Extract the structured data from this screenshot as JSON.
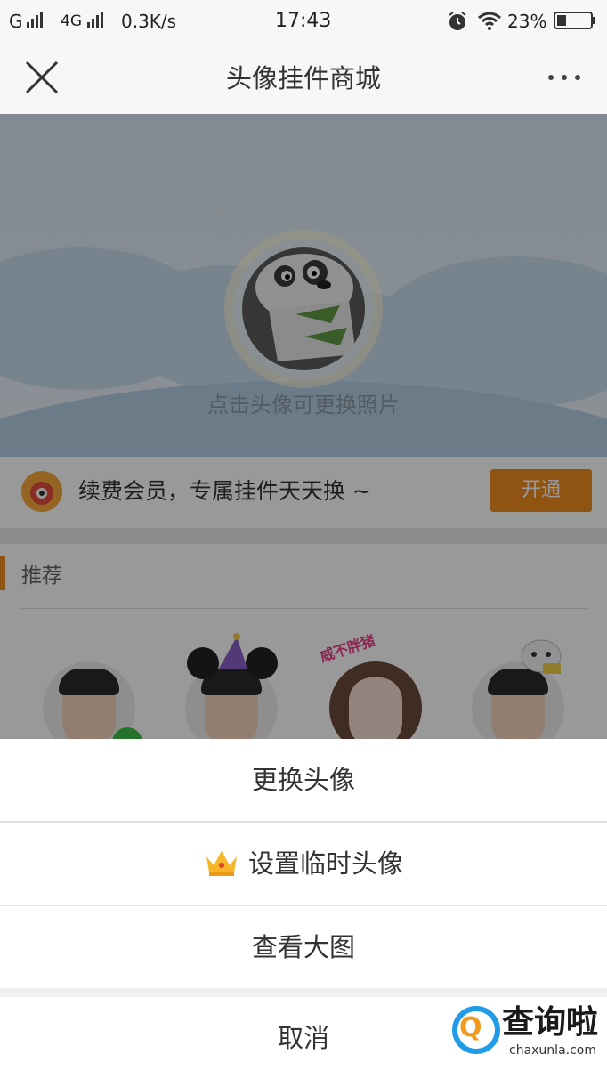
{
  "status_bar": {
    "carrier1": "G",
    "carrier2": "4G",
    "speed": "0.3K/s",
    "time": "17:43",
    "battery": "23%",
    "icons": [
      "signal-icon",
      "alarm-icon",
      "wifi-icon",
      "battery-icon"
    ]
  },
  "nav": {
    "title": "头像挂件商城",
    "close_icon": "close-icon",
    "more_icon": "more-icon"
  },
  "hero": {
    "hint": "点击头像可更换照片"
  },
  "vip": {
    "text": "续费会员，专属挂件天天换 ~",
    "button": "开通",
    "accent": "#f08c1e"
  },
  "recommend": {
    "label": "推荐",
    "stamp_text": "威不胖猪"
  },
  "action_sheet": {
    "items": [
      {
        "label": "更换头像"
      },
      {
        "label": "设置临时头像",
        "icon": "crown-icon"
      },
      {
        "label": "查看大图"
      }
    ],
    "cancel": "取消"
  },
  "watermark": {
    "title": "查询啦",
    "sub": "chaxunla.com",
    "logo_letter": "Q"
  }
}
